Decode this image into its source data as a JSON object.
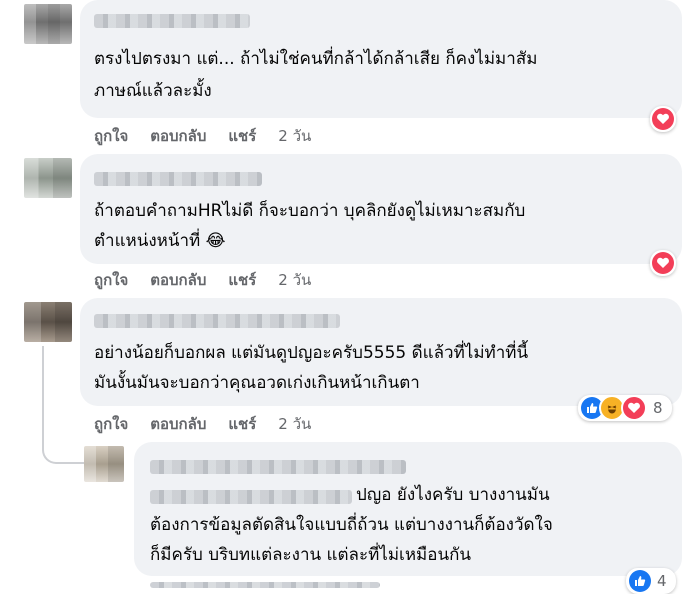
{
  "comments": [
    {
      "text_line1": "ตรงไปตรงมา แต่... ถ้าไม่ใช่คนที่กล้าได้กล้าเสีย ก็คงไม่มาสัม",
      "text_line2": "ภาษณ์แล้วละมั้ง",
      "like": "ถูกใจ",
      "reply": "ตอบกลับ",
      "share": "แชร์",
      "time": "2 วัน",
      "reactions": [
        "heart-icon"
      ]
    },
    {
      "text_line1": "ถ้าตอบคำถามHRไม่ดี ก็จะบอกว่า บุคลิกยังดูไม่เหมาะสมกับ",
      "text_line2": "ตำแหน่งหน้าที่ 😂",
      "like": "ถูกใจ",
      "reply": "ตอบกลับ",
      "share": "แชร์",
      "time": "2 วัน",
      "reactions": [
        "heart-icon"
      ]
    },
    {
      "text_line1": "อย่างน้อยก็บอกผล แต่มันดูปญอะครับ5555 ดีแล้วที่ไม่ทำที่นี้",
      "text_line2": "มันงั้นมันจะบอกว่าคุณอวดเก่งเกินหน้าเกินตา",
      "like": "ถูกใจ",
      "reply": "ตอบกลับ",
      "share": "แชร์",
      "time": "2 วัน",
      "reactions": [
        "like-icon",
        "haha-icon",
        "heart-icon"
      ],
      "reaction_count": "8"
    }
  ],
  "reply": {
    "text_line1": "ปญอ ยังไงครับ บางงานมัน",
    "text_line2": "ต้องการข้อมูลตัดสินใจแบบถี่ถ้วน แต่บางงานก็ต้องวัดใจ",
    "text_line3": "ก็มีครับ บริบทแต่ละงาน แต่ละที่ไม่เหมือนกัน",
    "reactions": [
      "like-icon"
    ],
    "reaction_count": "4"
  },
  "colors": {
    "bubble": "#f0f2f5",
    "action_text": "#65676b",
    "heart": "#f33e58",
    "like": "#1877f2",
    "haha": "#f7b125"
  }
}
